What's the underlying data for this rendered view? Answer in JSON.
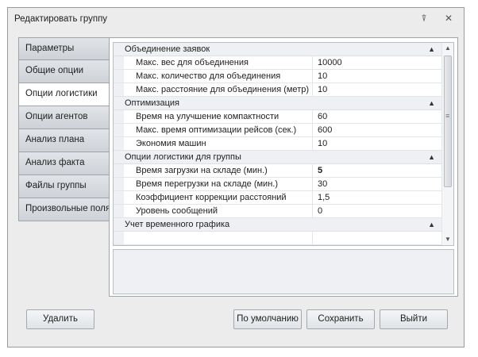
{
  "window": {
    "title": "Редактировать группу"
  },
  "tabs": [
    {
      "label": "Параметры"
    },
    {
      "label": "Общие опции"
    },
    {
      "label": "Опции логистики"
    },
    {
      "label": "Опции агентов"
    },
    {
      "label": "Анализ плана"
    },
    {
      "label": "Анализ факта"
    },
    {
      "label": "Файлы группы"
    },
    {
      "label": "Произвольные поля"
    }
  ],
  "active_tab": "Опции логистики",
  "properties": {
    "cat_merge": "Объединение заявок",
    "merge_rows": [
      {
        "name": "Макс. вес для объединения",
        "value": "10000"
      },
      {
        "name": "Макс. количество для объединения",
        "value": "10"
      },
      {
        "name": "Макс. расстояние для объединения (метр)",
        "value": "10"
      }
    ],
    "cat_opt": "Оптимизация",
    "opt_rows": [
      {
        "name": "Время на улучшение компактности",
        "value": "60"
      },
      {
        "name": "Макс. время оптимизации рейсов (сек.)",
        "value": "600"
      },
      {
        "name": "Экономия машин",
        "value": "10"
      }
    ],
    "cat_group": "Опции логистики для группы",
    "group_rows": [
      {
        "name": "Время загрузки на складе (мин.)",
        "value": "5"
      },
      {
        "name": "Время перегрузки на складе (мин.)",
        "value": "30"
      },
      {
        "name": "Коэффициент коррекции расстояний",
        "value": "1,5"
      },
      {
        "name": "Уровень сообщений",
        "value": "0"
      }
    ],
    "cat_time": "Учет временного графика"
  },
  "buttons": {
    "delete": "Удалить",
    "default": "По умолчанию",
    "save": "Сохранить",
    "exit": "Выйти"
  }
}
